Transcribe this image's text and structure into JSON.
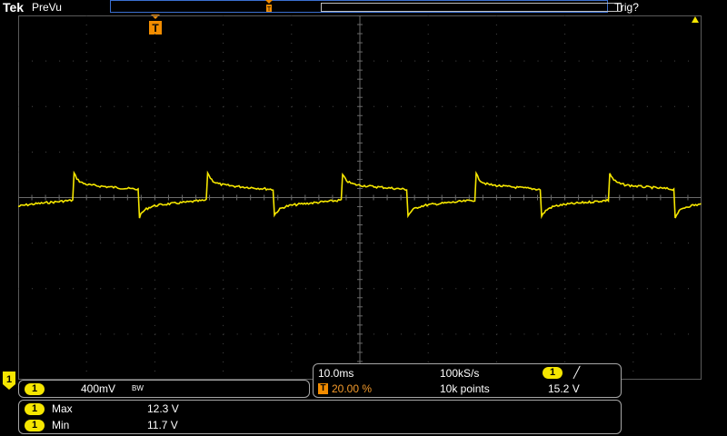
{
  "header": {
    "brand": "Tek",
    "mode": "PreVu",
    "trigger_status": "Trig?"
  },
  "markers": {
    "trigger_marker_label": "T",
    "record_trigger_label": "T",
    "channel_ground_label": "1"
  },
  "colors": {
    "trace": "#f5e600",
    "grid": "#4a4a4a",
    "trigger": "#f28c00",
    "record_bar": "#3b6fd0"
  },
  "channel_readout": {
    "channel": "1",
    "scale": "400mV",
    "bandwidth_flag": "BW"
  },
  "timebase_readout": {
    "horizontal_scale": "10.0ms",
    "sample_rate": "100kS/s",
    "trigger_channel": "1",
    "slope_icon": "rising-edge-icon",
    "slope_glyph": "╱",
    "trigger_position_icon": "T",
    "trigger_position": "20.00 %",
    "record_length": "10k points",
    "trigger_level": "15.2 V"
  },
  "measurements": [
    {
      "channel": "1",
      "name": "Max",
      "value": "12.3 V"
    },
    {
      "channel": "1",
      "name": "Min",
      "value": "11.7 V"
    }
  ],
  "waveform": {
    "channel": "1",
    "shape": "square wave with exponential settling",
    "period_divisions": 1.96,
    "high_level_divisions": 0.3,
    "low_level_divisions": -0.2
  }
}
